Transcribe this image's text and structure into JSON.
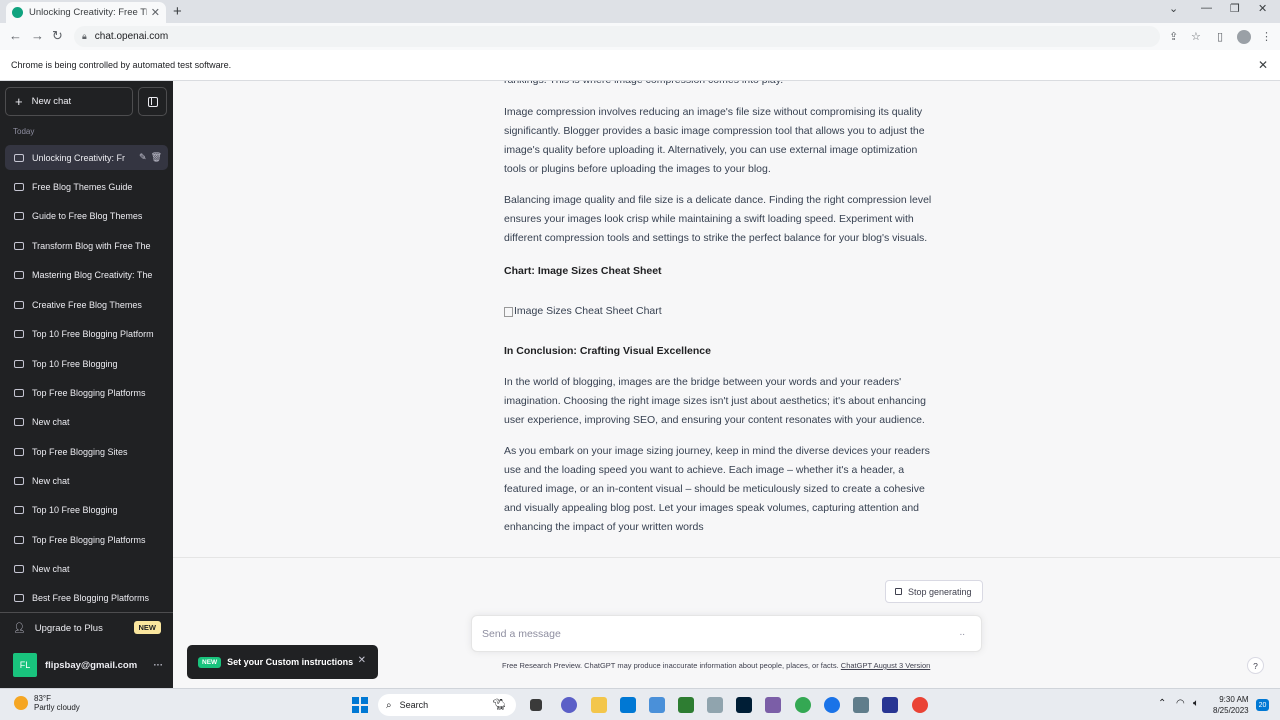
{
  "browser": {
    "tab_title": "Unlocking Creativity: Free Theme",
    "url": "chat.openai.com",
    "automation_notice": "Chrome is being controlled by automated test software."
  },
  "sidebar": {
    "new_chat_label": "New chat",
    "section_label": "Today",
    "items": [
      {
        "label": "Unlocking Creativity: Fr"
      },
      {
        "label": "Free Blog Themes Guide"
      },
      {
        "label": "Guide to Free Blog Themes"
      },
      {
        "label": "Transform Blog with Free The"
      },
      {
        "label": "Mastering Blog Creativity: The"
      },
      {
        "label": "Creative Free Blog Themes"
      },
      {
        "label": "Top 10 Free Blogging Platform"
      },
      {
        "label": "Top 10 Free Blogging"
      },
      {
        "label": "Top Free Blogging Platforms"
      },
      {
        "label": "New chat"
      },
      {
        "label": "Top Free Blogging Sites"
      },
      {
        "label": "New chat"
      },
      {
        "label": "Top 10 Free Blogging"
      },
      {
        "label": "Top Free Blogging Platforms"
      },
      {
        "label": "New chat"
      },
      {
        "label": "Best Free Blogging Platforms"
      }
    ],
    "upgrade_label": "Upgrade to Plus",
    "upgrade_badge": "NEW",
    "account_initials": "FL",
    "account_email": "flipsbay@gmail.com",
    "account_menu": "···"
  },
  "conversation": {
    "partial_top": "rankings. This is where image compression comes into play.",
    "p1": "Image compression involves reducing an image's file size without compromising its quality significantly. Blogger provides a basic image compression tool that allows you to adjust the image's quality before uploading it. Alternatively, you can use external image optimization tools or plugins before uploading the images to your blog.",
    "p2": "Balancing image quality and file size is a delicate dance. Finding the right compression level ensures your images look crisp while maintaining a swift loading speed. Experiment with different compression tools and settings to strike the perfect balance for your blog's visuals.",
    "h_chart": "Chart: Image Sizes Cheat Sheet",
    "img_alt": "Image Sizes Cheat Sheet Chart",
    "h_conclusion": "In Conclusion: Crafting Visual Excellence",
    "p3": "In the world of blogging, images are the bridge between your words and your readers' imagination. Choosing the right image sizes isn't just about aesthetics; it's about enhancing user experience, improving SEO, and ensuring your content resonates with your audience.",
    "p4": "As you embark on your image sizing journey, keep in mind the diverse devices your readers use and the loading speed you want to achieve. Each image – whether it's a header, a featured image, or an in-content visual – should be meticulously sized to create a cohesive and visually appealing blog post. Let your images speak volumes, capturing attention and enhancing the impact of your written words"
  },
  "composer": {
    "stop_label": "Stop generating",
    "placeholder": "Send a message",
    "send_glyph": "..",
    "footnote": "Free Research Preview. ChatGPT may produce inaccurate information about people, places, or facts.",
    "footnote_link": "ChatGPT August 3 Version",
    "help": "?"
  },
  "toast": {
    "badge": "NEW",
    "text": "Set your Custom instructions"
  },
  "taskbar": {
    "temp": "83°F",
    "condition": "Partly cloudy",
    "search_label": "Search",
    "time": "9:30 AM",
    "date": "8/25/2023",
    "notifications": "20"
  }
}
